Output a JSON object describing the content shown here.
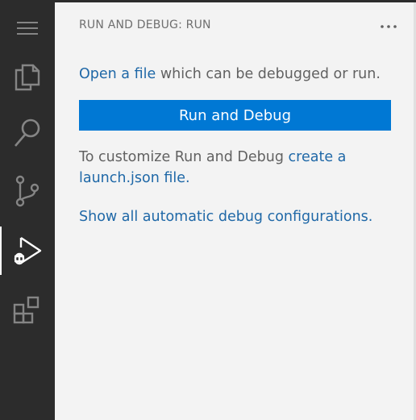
{
  "activity_bar": {
    "icons": [
      "menu-icon",
      "explorer-icon",
      "search-icon",
      "source-control-icon",
      "run-debug-icon",
      "extensions-icon"
    ],
    "icon_color": "#858585",
    "active_icon_color": "#ffffff"
  },
  "panel": {
    "title": "RUN AND DEBUG: RUN",
    "more_icon": "ellipsis-icon"
  },
  "content": {
    "open_file_link": "Open a file",
    "open_file_rest": " which can be debugged or run.",
    "run_button_label": "Run and Debug",
    "customize_text": "To customize Run and Debug ",
    "create_launch_link": "create a launch.json file.",
    "show_all_link": "Show all automatic debug configurations."
  },
  "colors": {
    "accent": "#0078d4",
    "link": "#1f68a7",
    "activity_bar_bg": "#2c2c2c",
    "panel_bg": "#f3f3f3"
  }
}
